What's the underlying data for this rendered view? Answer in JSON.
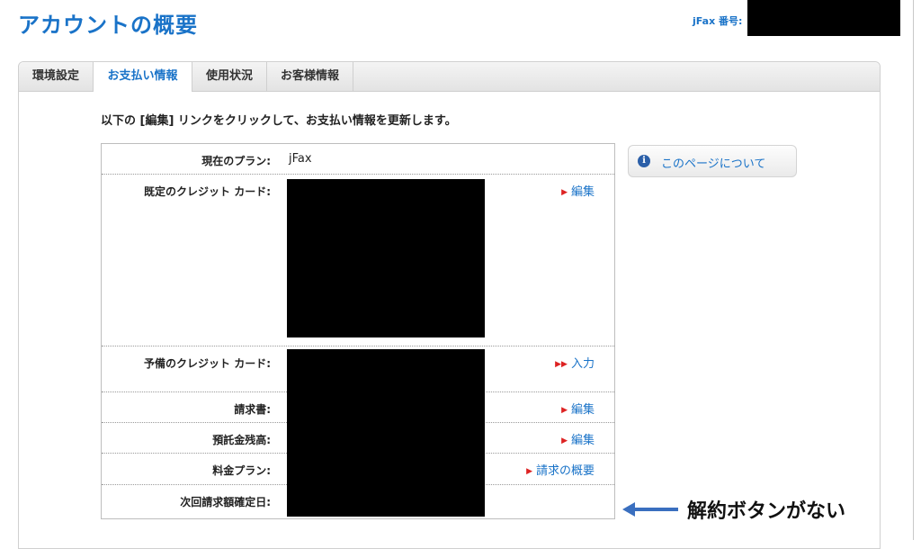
{
  "header": {
    "title": "アカウントの概要",
    "jfax_number_label": "jFax 番号:"
  },
  "tabs": [
    {
      "label": "環境設定",
      "active": false
    },
    {
      "label": "お支払い情報",
      "active": true
    },
    {
      "label": "使用状況",
      "active": false
    },
    {
      "label": "お客様情報",
      "active": false
    }
  ],
  "main": {
    "instruction": "以下の [編集] リンクをクリックして、お支払い情報を更新します。",
    "rows": [
      {
        "label": "現在のプラン:",
        "value": "jFax",
        "action": ""
      },
      {
        "label": "既定のクレジット カード:",
        "value": "",
        "action": "編集"
      },
      {
        "label": "予備のクレジット カード:",
        "value": "",
        "action": "入力"
      },
      {
        "label": "請求書:",
        "value": "",
        "action": "編集"
      },
      {
        "label": "預託金残高:",
        "value": "",
        "action": "編集"
      },
      {
        "label": "料金プラン:",
        "value": "",
        "action": "請求の概要"
      },
      {
        "label": "次回請求額確定日:",
        "value": "",
        "action": ""
      }
    ]
  },
  "side": {
    "about_page_label": "このページについて",
    "info_icon": "info-icon"
  },
  "annotation": {
    "text": "解約ボタンがない",
    "color": "#3a6fbf"
  },
  "colors": {
    "accent": "#1a73c8",
    "action_arrow": "#dd2222"
  }
}
